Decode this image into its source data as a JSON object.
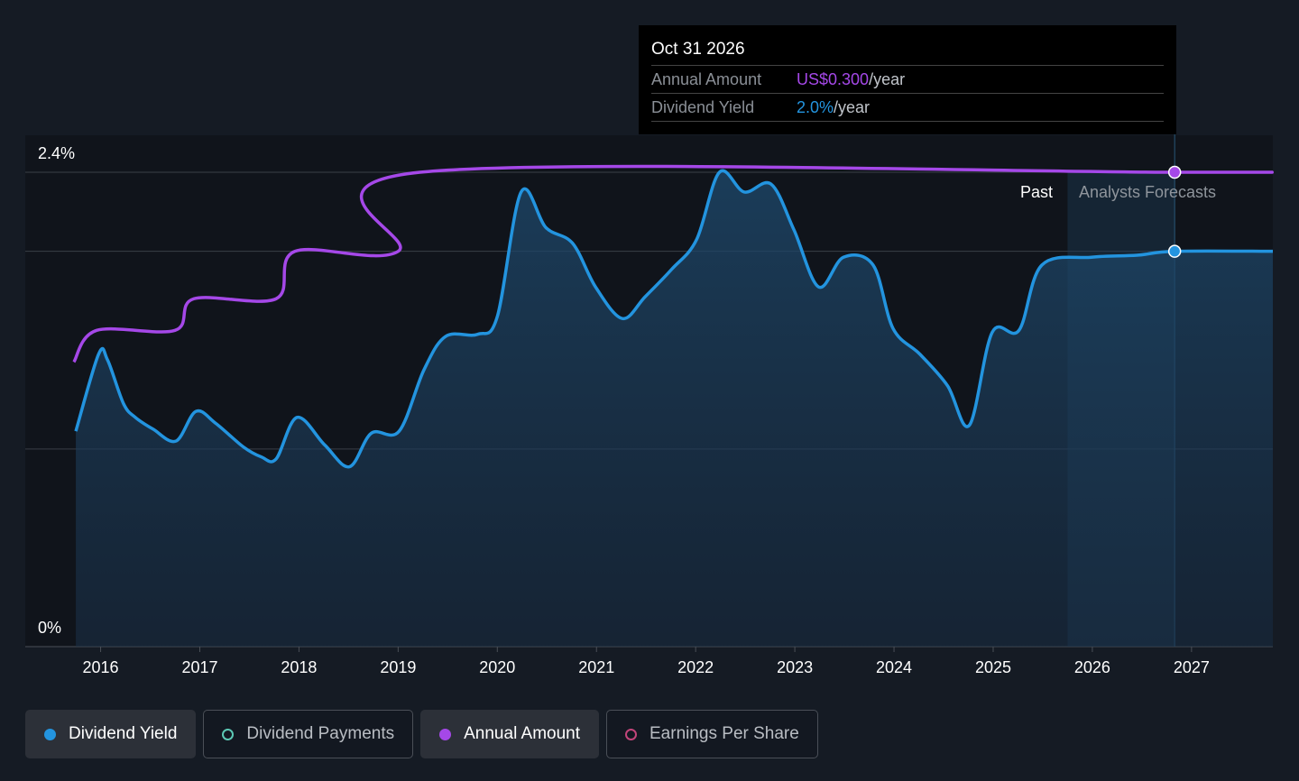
{
  "chart_data": {
    "type": "line",
    "y_axis": {
      "ticks": [
        {
          "value": 2.4,
          "label": "2.4%"
        },
        {
          "value": 0,
          "label": "0%"
        }
      ],
      "gridlines": [
        1.0,
        2.0,
        2.4
      ],
      "ylim": [
        0,
        2.4
      ]
    },
    "x_axis": {
      "ticks": [
        "2016",
        "2017",
        "2018",
        "2019",
        "2020",
        "2021",
        "2022",
        "2023",
        "2024",
        "2025",
        "2026",
        "2027"
      ],
      "xlim": [
        2015.24,
        2027.82
      ]
    },
    "regions": {
      "past_label": "Past",
      "forecast_label": "Analysts Forecasts",
      "forecast_start": 2025.75,
      "forecast_end": 2026.83
    },
    "series": [
      {
        "name": "Dividend Yield",
        "unit": "%",
        "color": "#2394df",
        "x": [
          2015.75,
          2015.98,
          2016.07,
          2016.23,
          2016.35,
          2016.53,
          2016.76,
          2016.96,
          2017.16,
          2017.44,
          2017.62,
          2017.77,
          2017.98,
          2018.26,
          2018.51,
          2018.73,
          2019.01,
          2019.26,
          2019.48,
          2019.8,
          2020.0,
          2020.24,
          2020.49,
          2020.76,
          2020.99,
          2021.26,
          2021.49,
          2021.76,
          2022.01,
          2022.24,
          2022.49,
          2022.76,
          2022.99,
          2023.24,
          2023.49,
          2023.79,
          2023.99,
          2024.26,
          2024.54,
          2024.76,
          2024.99,
          2025.26,
          2025.49,
          2025.99,
          2026.45,
          2026.83,
          2027.82
        ],
        "values": [
          1.09,
          1.48,
          1.45,
          1.23,
          1.16,
          1.1,
          1.04,
          1.19,
          1.13,
          1.01,
          0.96,
          0.95,
          1.16,
          1.02,
          0.91,
          1.08,
          1.09,
          1.4,
          1.57,
          1.58,
          1.67,
          2.3,
          2.12,
          2.04,
          1.82,
          1.66,
          1.77,
          1.91,
          2.06,
          2.4,
          2.3,
          2.34,
          2.11,
          1.82,
          1.97,
          1.93,
          1.61,
          1.48,
          1.32,
          1.12,
          1.59,
          1.6,
          1.93,
          1.97,
          1.98,
          2.0,
          2.0
        ]
      },
      {
        "name": "Annual Amount",
        "unit": "US$",
        "color": "#a548e8",
        "max_scale": 0.3,
        "x": [
          2015.73,
          2015.96,
          2016.75,
          2016.94,
          2017.77,
          2017.96,
          2019.0,
          2019.22,
          2026.83,
          2027.82
        ],
        "values": [
          0.18,
          0.2,
          0.2,
          0.22,
          0.22,
          0.25,
          0.25,
          0.3,
          0.3,
          0.3
        ]
      }
    ]
  },
  "tooltip": {
    "date": "Oct 31 2026",
    "rows": [
      {
        "label": "Annual Amount",
        "value": "US$0.300",
        "suffix": "/year",
        "color": "#a548e8"
      },
      {
        "label": "Dividend Yield",
        "value": "2.0%",
        "suffix": "/year",
        "color": "#2394df"
      }
    ]
  },
  "legend": [
    {
      "label": "Dividend Yield",
      "active": true,
      "color": "#2394df"
    },
    {
      "label": "Dividend Payments",
      "active": false,
      "color": "#5cc9b5"
    },
    {
      "label": "Annual Amount",
      "active": true,
      "color": "#a548e8"
    },
    {
      "label": "Earnings Per Share",
      "active": false,
      "color": "#c2457a"
    }
  ]
}
